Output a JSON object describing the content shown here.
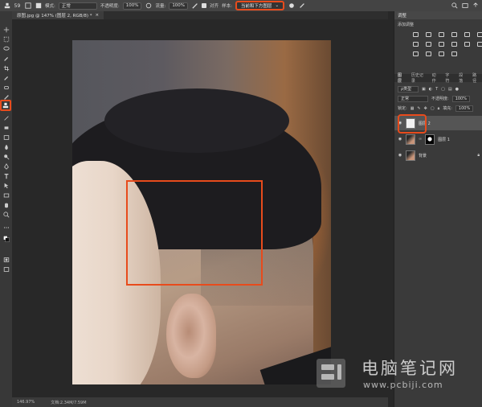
{
  "options_bar": {
    "brush_size": "59",
    "mode_label": "模式:",
    "mode_value": "正常",
    "opacity_label": "不透明度:",
    "opacity_value": "100%",
    "flow_label": "流量:",
    "flow_value": "100%",
    "aligned_label": "对齐",
    "sample_label": "样本:",
    "sample_value": "当前和下方图层"
  },
  "document_tab": {
    "title": "原图.jpg @ 147% (图层 2, RGB/8) *",
    "close": "×"
  },
  "status_bar": {
    "zoom": "146.97%",
    "doc_info": "文档:2.34M/7.59M"
  },
  "panel": {
    "adjust_tab": "调整",
    "adjust_title": "添加调整",
    "layer_tabs": [
      "图层",
      "历史记录",
      "动作",
      "字符",
      "段落",
      "路径"
    ],
    "kind_label": "ρ类型",
    "blend_mode": "正常",
    "opacity_label": "不透明度:",
    "opacity_value": "100%",
    "lock_label": "锁定:",
    "fill_label": "填充:",
    "fill_value": "100%",
    "layers": [
      {
        "name": "图层 2",
        "selected": true
      },
      {
        "name": "图层 1",
        "selected": false
      },
      {
        "name": "背景",
        "selected": false
      }
    ]
  },
  "watermark": {
    "title": "电脑笔记网",
    "url": "www.pcbiji.com"
  },
  "colors": {
    "highlight": "#e84b1c",
    "ui_dark": "#282828",
    "panel": "#3a3a3a"
  }
}
